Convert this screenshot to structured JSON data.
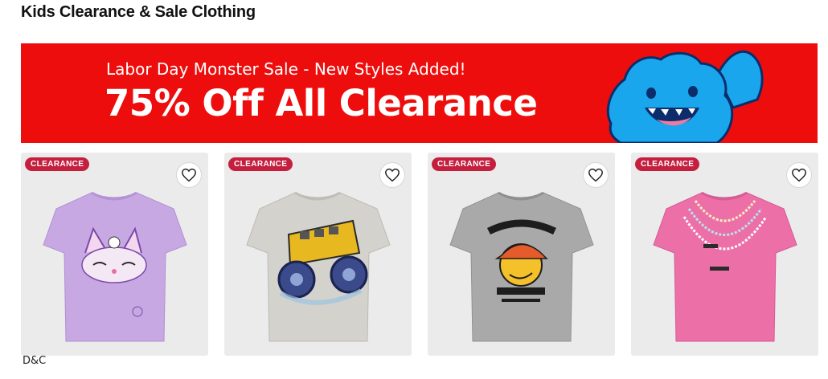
{
  "page": {
    "title": "Kids Clearance & Sale Clothing"
  },
  "banner": {
    "subtitle": "Labor Day Monster Sale - New Styles Added!",
    "headline": "75% Off All Clearance",
    "background_color": "#ee0d0d",
    "mascot_icon": "blue-monster-icon"
  },
  "products": [
    {
      "badge": "CLEARANCE",
      "icon": "purple-cat-unicorn-tshirt",
      "color": "#c8a8e3"
    },
    {
      "badge": "CLEARANCE",
      "icon": "gray-monster-truck-bus-tshirt",
      "color": "#d4d2cd"
    },
    {
      "badge": "CLEARANCE",
      "icon": "gray-bruh-emoji-tshirt",
      "color": "#a9a9a9"
    },
    {
      "badge": "CLEARANCE",
      "icon": "pink-beaded-necklace-tshirt",
      "color": "#ec6fa8"
    }
  ],
  "footer": {
    "brand": "D&C"
  },
  "colors": {
    "badge": "#c51f3e",
    "card_bg": "#ebebeb"
  }
}
